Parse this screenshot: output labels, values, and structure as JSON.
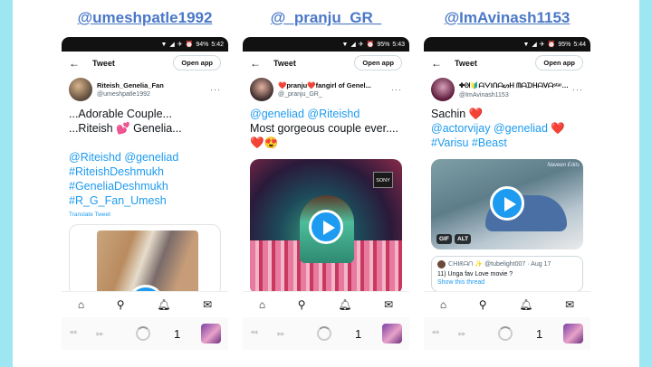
{
  "columns": [
    {
      "handle": "@umeshpatle1992",
      "status": {
        "battery": "94%",
        "time": "5:42"
      },
      "header": {
        "title": "Tweet",
        "open_app": "Open app"
      },
      "author": {
        "display_name": "Riteish_Genelia_Fan",
        "username": "@umeshpatle1992"
      },
      "lines": [
        [
          {
            "t": "...Adorable Couple...",
            "link": false
          }
        ],
        [
          {
            "t": "...Riteish 💕 Genelia...",
            "link": false
          }
        ],
        [
          {
            "t": "",
            "link": false
          }
        ],
        [
          {
            "t": "@Riteishd @geneliad",
            "link": true
          }
        ],
        [
          {
            "t": "#RiteishDeshmukh",
            "link": true
          }
        ],
        [
          {
            "t": "#GeneliaDeshmukh",
            "link": true
          }
        ],
        [
          {
            "t": "#R_G_Fan_Umesh",
            "link": true
          }
        ]
      ],
      "translate": "Translate Tweet",
      "page_number": "1"
    },
    {
      "handle": "@_pranju_GR_",
      "status": {
        "battery": "95%",
        "time": "5:43"
      },
      "header": {
        "title": "Tweet",
        "open_app": "Open app"
      },
      "author": {
        "display_name": "❤️pranju❤️fangirl of Genel...",
        "username": "@_pranju_GR_"
      },
      "lines": [
        [
          {
            "t": "@geneliad @Riteishd",
            "link": true
          }
        ],
        [
          {
            "t": "Most gorgeous couple ever....",
            "link": false
          }
        ],
        [
          {
            "t": "❤️😍",
            "link": false
          }
        ]
      ],
      "media_label": "SONY",
      "page_number": "1"
    },
    {
      "handle": "@ImAvinash1153",
      "status": {
        "battery": "95%",
        "time": "5:44"
      },
      "header": {
        "title": "Tweet",
        "open_app": "Open app"
      },
      "author": {
        "display_name": "✤ᘛ🔰⁠ᗩᐯIᑎᗩᔕᕼ ᗰᗩᗪᕼᗩᐯᗩ⁠ˢᵗᵃʳ🔰ᘚ✤",
        "username": "@ImAvinash1153"
      },
      "lines": [
        [
          {
            "t": "Sachin ❤️",
            "link": false
          }
        ],
        [
          {
            "t": "@actorvijay @geneliad ❤️",
            "link": true
          }
        ],
        [
          {
            "t": "#Varisu #Beast",
            "link": true
          }
        ]
      ],
      "gif_badges": [
        "GIF",
        "ALT"
      ],
      "watermark": "Naveen Edits",
      "quote": {
        "author": "ᑕᕼIᖇᗩᑎ ✨ @tubelight007 · Aug 17",
        "text": "11) Unga fav Love movie ?",
        "more": "Show this thread"
      },
      "page_number": "1"
    }
  ],
  "nav_icons": [
    "home-icon",
    "search-icon",
    "bell-icon",
    "mail-icon"
  ],
  "colors": {
    "background": "#9ee7f2",
    "handle": "#4a78c7",
    "link": "#1d9bf0",
    "play": "#1d9bf0"
  }
}
